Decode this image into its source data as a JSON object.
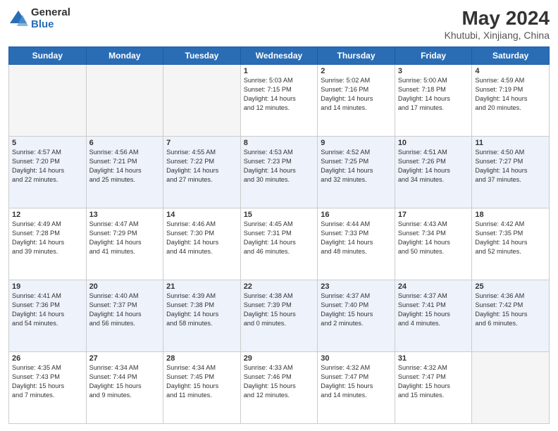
{
  "header": {
    "logo_general": "General",
    "logo_blue": "Blue",
    "title": "May 2024",
    "subtitle": "Khutubi, Xinjiang, China"
  },
  "days_of_week": [
    "Sunday",
    "Monday",
    "Tuesday",
    "Wednesday",
    "Thursday",
    "Friday",
    "Saturday"
  ],
  "weeks": [
    [
      {
        "day": "",
        "info": ""
      },
      {
        "day": "",
        "info": ""
      },
      {
        "day": "",
        "info": ""
      },
      {
        "day": "1",
        "info": "Sunrise: 5:03 AM\nSunset: 7:15 PM\nDaylight: 14 hours\nand 12 minutes."
      },
      {
        "day": "2",
        "info": "Sunrise: 5:02 AM\nSunset: 7:16 PM\nDaylight: 14 hours\nand 14 minutes."
      },
      {
        "day": "3",
        "info": "Sunrise: 5:00 AM\nSunset: 7:18 PM\nDaylight: 14 hours\nand 17 minutes."
      },
      {
        "day": "4",
        "info": "Sunrise: 4:59 AM\nSunset: 7:19 PM\nDaylight: 14 hours\nand 20 minutes."
      }
    ],
    [
      {
        "day": "5",
        "info": "Sunrise: 4:57 AM\nSunset: 7:20 PM\nDaylight: 14 hours\nand 22 minutes."
      },
      {
        "day": "6",
        "info": "Sunrise: 4:56 AM\nSunset: 7:21 PM\nDaylight: 14 hours\nand 25 minutes."
      },
      {
        "day": "7",
        "info": "Sunrise: 4:55 AM\nSunset: 7:22 PM\nDaylight: 14 hours\nand 27 minutes."
      },
      {
        "day": "8",
        "info": "Sunrise: 4:53 AM\nSunset: 7:23 PM\nDaylight: 14 hours\nand 30 minutes."
      },
      {
        "day": "9",
        "info": "Sunrise: 4:52 AM\nSunset: 7:25 PM\nDaylight: 14 hours\nand 32 minutes."
      },
      {
        "day": "10",
        "info": "Sunrise: 4:51 AM\nSunset: 7:26 PM\nDaylight: 14 hours\nand 34 minutes."
      },
      {
        "day": "11",
        "info": "Sunrise: 4:50 AM\nSunset: 7:27 PM\nDaylight: 14 hours\nand 37 minutes."
      }
    ],
    [
      {
        "day": "12",
        "info": "Sunrise: 4:49 AM\nSunset: 7:28 PM\nDaylight: 14 hours\nand 39 minutes."
      },
      {
        "day": "13",
        "info": "Sunrise: 4:47 AM\nSunset: 7:29 PM\nDaylight: 14 hours\nand 41 minutes."
      },
      {
        "day": "14",
        "info": "Sunrise: 4:46 AM\nSunset: 7:30 PM\nDaylight: 14 hours\nand 44 minutes."
      },
      {
        "day": "15",
        "info": "Sunrise: 4:45 AM\nSunset: 7:31 PM\nDaylight: 14 hours\nand 46 minutes."
      },
      {
        "day": "16",
        "info": "Sunrise: 4:44 AM\nSunset: 7:33 PM\nDaylight: 14 hours\nand 48 minutes."
      },
      {
        "day": "17",
        "info": "Sunrise: 4:43 AM\nSunset: 7:34 PM\nDaylight: 14 hours\nand 50 minutes."
      },
      {
        "day": "18",
        "info": "Sunrise: 4:42 AM\nSunset: 7:35 PM\nDaylight: 14 hours\nand 52 minutes."
      }
    ],
    [
      {
        "day": "19",
        "info": "Sunrise: 4:41 AM\nSunset: 7:36 PM\nDaylight: 14 hours\nand 54 minutes."
      },
      {
        "day": "20",
        "info": "Sunrise: 4:40 AM\nSunset: 7:37 PM\nDaylight: 14 hours\nand 56 minutes."
      },
      {
        "day": "21",
        "info": "Sunrise: 4:39 AM\nSunset: 7:38 PM\nDaylight: 14 hours\nand 58 minutes."
      },
      {
        "day": "22",
        "info": "Sunrise: 4:38 AM\nSunset: 7:39 PM\nDaylight: 15 hours\nand 0 minutes."
      },
      {
        "day": "23",
        "info": "Sunrise: 4:37 AM\nSunset: 7:40 PM\nDaylight: 15 hours\nand 2 minutes."
      },
      {
        "day": "24",
        "info": "Sunrise: 4:37 AM\nSunset: 7:41 PM\nDaylight: 15 hours\nand 4 minutes."
      },
      {
        "day": "25",
        "info": "Sunrise: 4:36 AM\nSunset: 7:42 PM\nDaylight: 15 hours\nand 6 minutes."
      }
    ],
    [
      {
        "day": "26",
        "info": "Sunrise: 4:35 AM\nSunset: 7:43 PM\nDaylight: 15 hours\nand 7 minutes."
      },
      {
        "day": "27",
        "info": "Sunrise: 4:34 AM\nSunset: 7:44 PM\nDaylight: 15 hours\nand 9 minutes."
      },
      {
        "day": "28",
        "info": "Sunrise: 4:34 AM\nSunset: 7:45 PM\nDaylight: 15 hours\nand 11 minutes."
      },
      {
        "day": "29",
        "info": "Sunrise: 4:33 AM\nSunset: 7:46 PM\nDaylight: 15 hours\nand 12 minutes."
      },
      {
        "day": "30",
        "info": "Sunrise: 4:32 AM\nSunset: 7:47 PM\nDaylight: 15 hours\nand 14 minutes."
      },
      {
        "day": "31",
        "info": "Sunrise: 4:32 AM\nSunset: 7:47 PM\nDaylight: 15 hours\nand 15 minutes."
      },
      {
        "day": "",
        "info": ""
      }
    ]
  ]
}
